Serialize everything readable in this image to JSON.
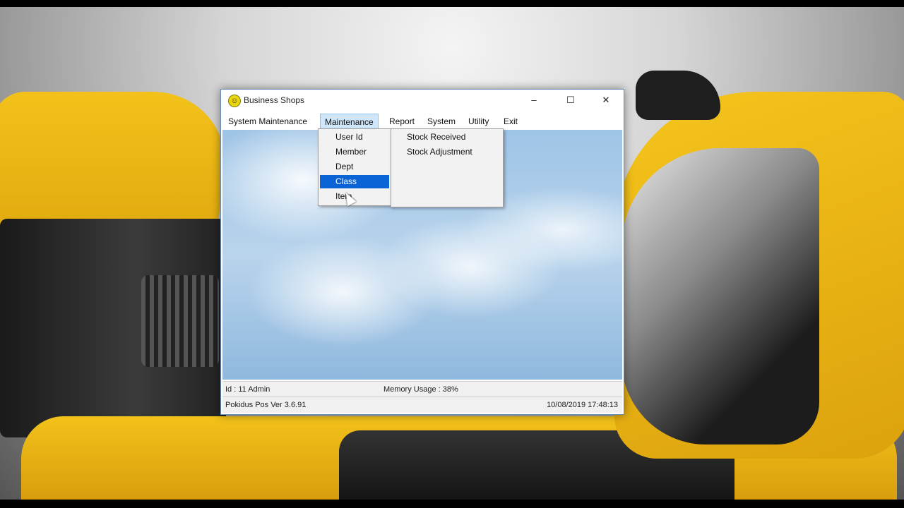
{
  "window": {
    "title": "Business Shops",
    "controls": {
      "minimize": "–",
      "maximize": "☐",
      "close": "✕"
    },
    "icon": "smiley-icon"
  },
  "menu": {
    "items": [
      "System Maintenance",
      "Maintenance",
      "Report",
      "System",
      "Utility",
      "Exit"
    ],
    "open": "Maintenance"
  },
  "maintenance_dropdown": {
    "items": [
      "User Id",
      "Member",
      "Dept",
      "Class",
      "Item"
    ],
    "highlighted": "Class"
  },
  "submenu": {
    "items": [
      "Stock Received",
      "Stock Adjustment"
    ]
  },
  "status_bar": {
    "user": "Id : 11 Admin",
    "memory": "Memory Usage : 38%",
    "version": "Pokidus Pos Ver 3.6.91",
    "datetime": "10/08/2019 17:48:13"
  },
  "colors": {
    "menu_highlight": "#0a64d6",
    "open_menu_bg": "#cfe6fb",
    "window_border": "#6a8fbf"
  }
}
